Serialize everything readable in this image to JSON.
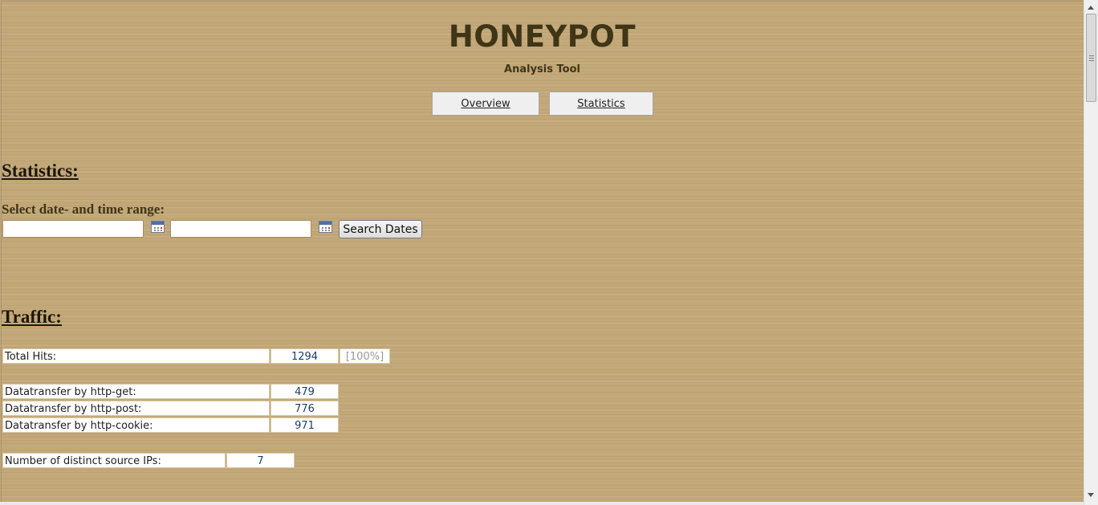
{
  "header": {
    "title": "HONEYPOT",
    "subtitle": "Analysis Tool"
  },
  "nav": {
    "overview_label": "Overview",
    "statistics_label": "Statistics"
  },
  "statistics": {
    "heading": "Statistics:",
    "range_label": "Select date- and time range:",
    "date_from_value": "",
    "date_to_value": "",
    "search_button_label": "Search Dates"
  },
  "traffic": {
    "heading": "Traffic:",
    "total_hits": {
      "label": "Total Hits:",
      "value": "1294",
      "percent": "[100%]"
    },
    "transfers": [
      {
        "label": "Datatransfer by http-get:",
        "value": "479"
      },
      {
        "label": "Datatransfer by http-post:",
        "value": "776"
      },
      {
        "label": "Datatransfer by http-cookie:",
        "value": "971"
      }
    ],
    "distinct_ips": {
      "label": "Number of distinct source IPs:",
      "value": "7"
    }
  },
  "icons": {
    "calendar": "calendar-icon",
    "scroll_up": "scroll-up-arrow-icon",
    "scroll_down": "scroll-down-arrow-icon"
  },
  "colors": {
    "background": "#c3a878",
    "title": "#3f3517",
    "value_text": "#1f3c6b",
    "percent_text": "#9a9a9a"
  }
}
